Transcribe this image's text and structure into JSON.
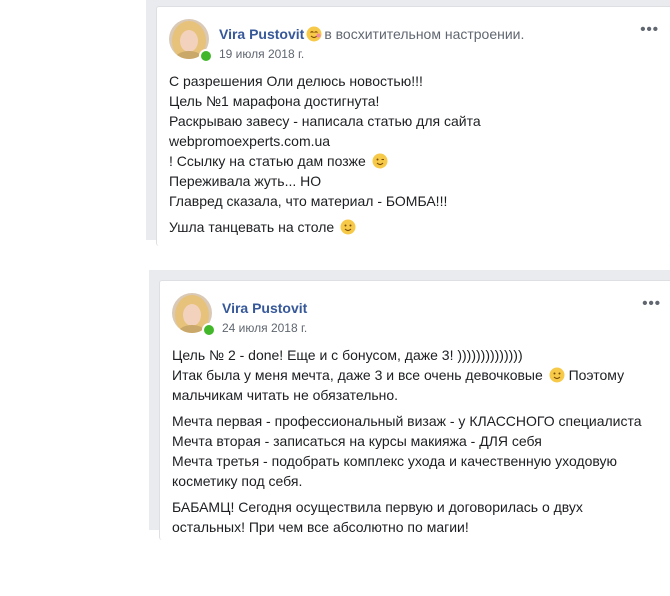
{
  "posts": [
    {
      "author": "Vira Pustovit",
      "feeling": "в восхитительном настроении.",
      "date": "19 июля 2018 г.",
      "more": "•••",
      "paragraphs": [
        {
          "lines": [
            "С разрешения Оли делюсь новостью!!!",
            "Цель №1 марафона достигнута!",
            "Раскрываю завесу - написала статью для сайта",
            "webpromoexperts.com.ua",
            "! Ссылку на статью дам позже",
            "Переживала жуть... НО",
            "Главред сказала, что материал - БОМБА!!!"
          ]
        },
        {
          "lines": [
            "Ушла танцевать на столе"
          ]
        }
      ]
    },
    {
      "author": "Vira Pustovit",
      "date": "24 июля 2018 г.",
      "more": "•••",
      "paragraphs": [
        {
          "lines": [
            "Цель № 2 - done! Еще и с бонусом, даже 3! ))))))))))))))",
            "Итак была у меня мечта, даже 3 и все очень девочковые",
            "Поэтому",
            "мальчикам читать не обязательно."
          ]
        },
        {
          "lines": [
            "Мечта первая - профессиональный визаж - у КЛАССНОГО специалиста",
            "Мечта вторая - записаться на курсы макияжа - ДЛЯ себя",
            "Мечта третья - подобрать комплекс ухода и качественную уходовую",
            "косметику под себя."
          ]
        },
        {
          "lines": [
            "БАБАМЦ! Сегодня осуществила первую и договорилась о двух",
            "остальных! При чем все абсолютно по магии!"
          ]
        }
      ]
    }
  ]
}
